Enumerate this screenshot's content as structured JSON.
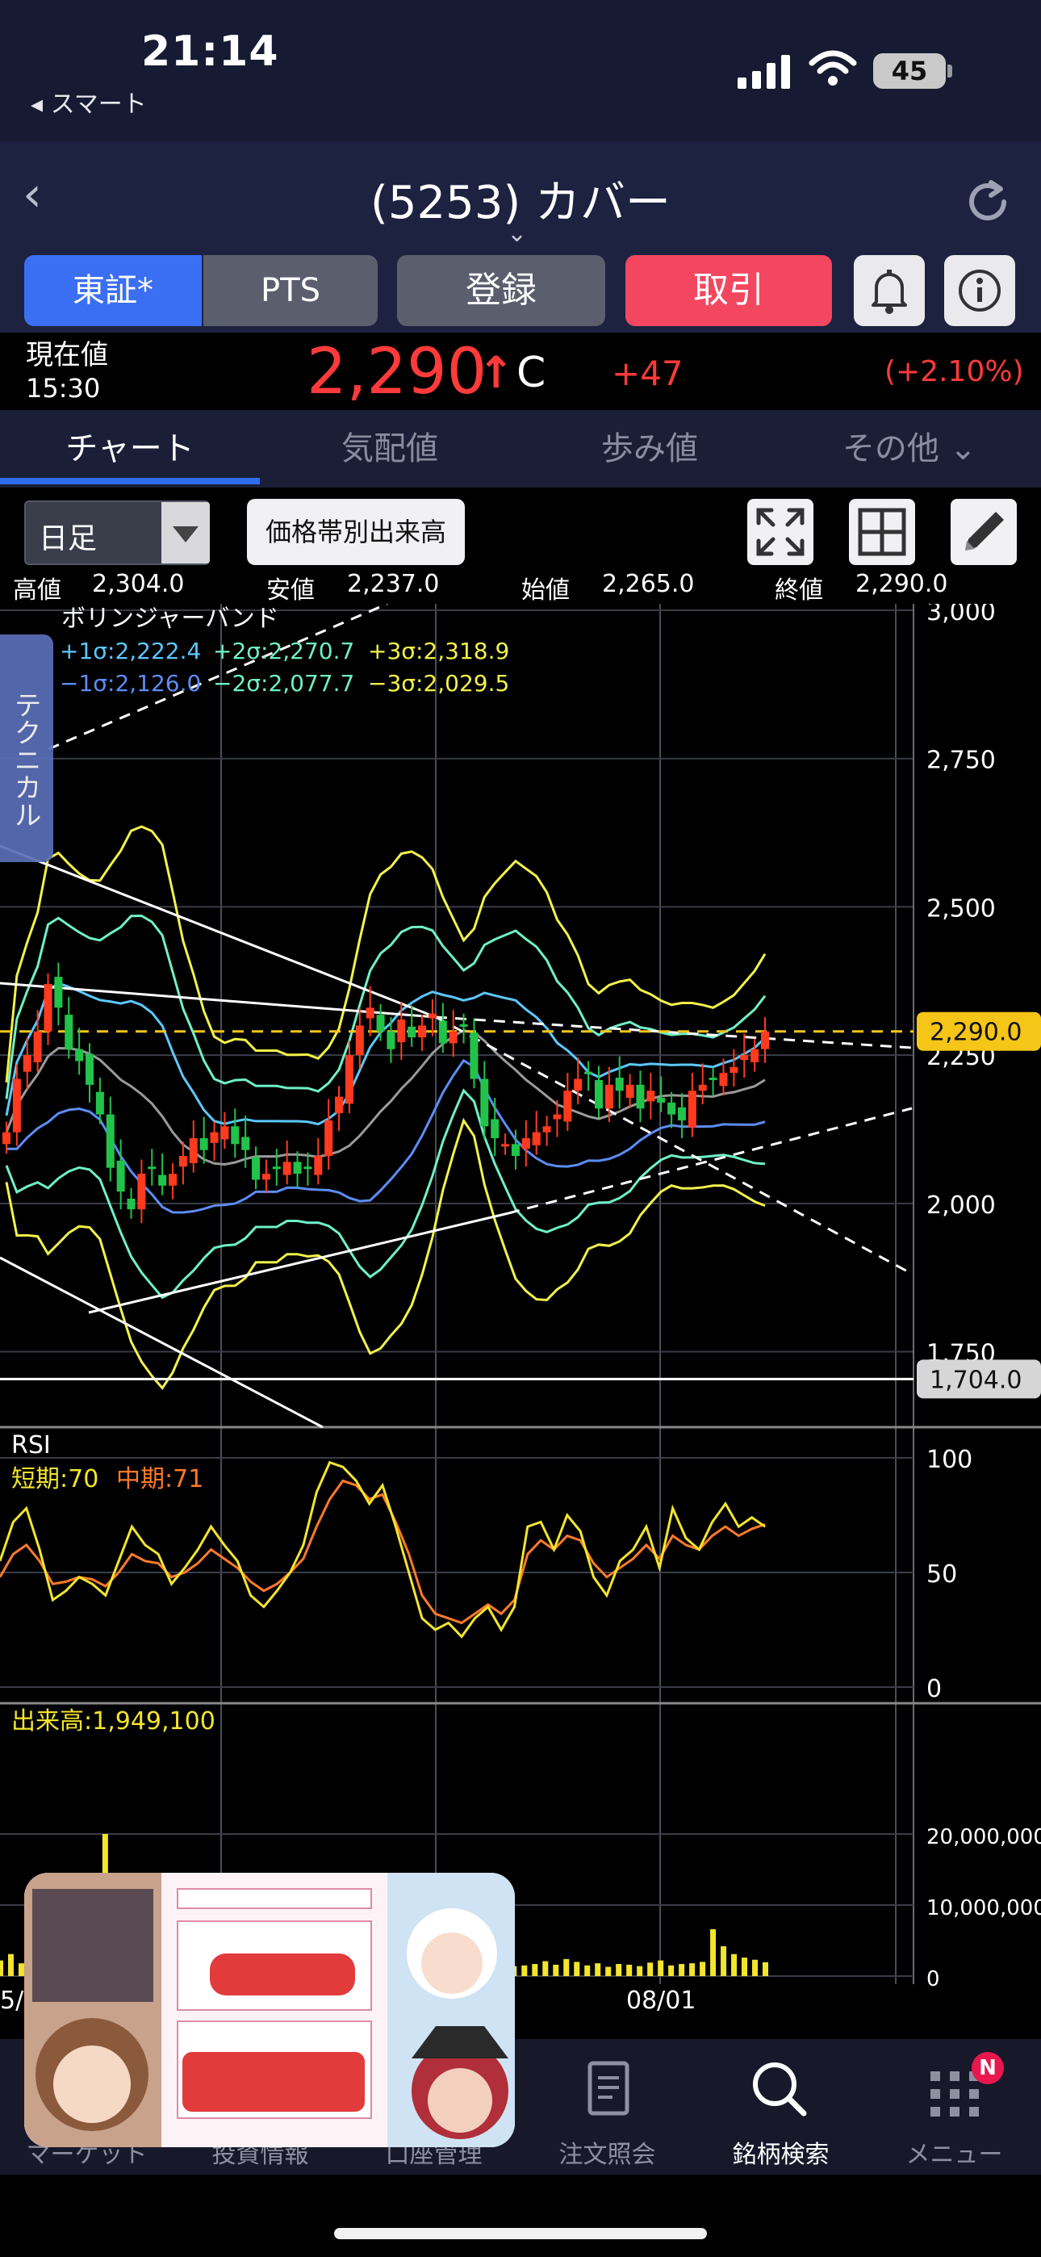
{
  "status": {
    "time": "21:14",
    "back_app": "◂ スマート",
    "battery": "45"
  },
  "nav": {
    "title": "(5253) カバー"
  },
  "buttons": {
    "tse": "東証*",
    "pts": "PTS",
    "register": "登録",
    "trade": "取引"
  },
  "price": {
    "label": "現在値",
    "time": "15:30",
    "value": "2,290",
    "arrow": "↑",
    "flag": "C",
    "change": "+47",
    "change_pct": "(+2.10%)"
  },
  "tabs": [
    "チャート",
    "気配値",
    "歩み値",
    "その他 ⌄"
  ],
  "toolbar": {
    "period": "日足",
    "volume_profile": "価格帯別出来高"
  },
  "ohlc": {
    "high_label": "高値",
    "high": "2,304.0",
    "low_label": "安値",
    "low": "2,237.0",
    "open_label": "始値",
    "open": "2,265.0",
    "close_label": "終値",
    "close": "2,290.0"
  },
  "side_tab": "テクニカル",
  "colors": {
    "up": "#ff3a1f",
    "down": "#22c34a",
    "bb_yellow": "#f2f24a",
    "bb_green": "#6ff0c8",
    "bb_blue": "#5c8df5",
    "rsi_short": "#f2e52c",
    "rsi_mid": "#ff7a2a",
    "current_price": "#f5c518"
  },
  "chart_data": [
    {
      "type": "candlestick",
      "title": "ボリンジャーバンド",
      "legend": {
        "p1": "+1σ:2,222.4",
        "p2": "+2σ:2,270.7",
        "p3": "+3σ:2,318.9",
        "m1": "−1σ:2,126.0",
        "m2": "−2σ:2,077.7",
        "m3": "−3σ:2,029.5"
      },
      "y_ticks": [
        "3,000",
        "2,750",
        "2,500",
        "2,250",
        "2,000",
        "1,750"
      ],
      "ylim": [
        1650,
        3000
      ],
      "current_price_label": "2,290.0",
      "support_label": "1,704.0",
      "x_tick_labels": [
        "5/",
        "08/01"
      ],
      "closes": [
        2120,
        2210,
        2250,
        2290,
        2370,
        2330,
        2260,
        2240,
        2200,
        2150,
        2060,
        2020,
        1990,
        2050,
        2060,
        2030,
        2050,
        2080,
        2110,
        2090,
        2120,
        2130,
        2100,
        2090,
        2040,
        2050,
        2060,
        2070,
        2050,
        2060,
        2080,
        2140,
        2180,
        2250,
        2300,
        2330,
        2290,
        2260,
        2310,
        2280,
        2300,
        2320,
        2270,
        2290,
        2300,
        2210,
        2130,
        2110,
        2100,
        2080,
        2110,
        2120,
        2130,
        2150,
        2190,
        2210,
        2220,
        2160,
        2200,
        2190,
        2200,
        2160,
        2190,
        2170,
        2150,
        2140,
        2190,
        2200,
        2210,
        2220,
        2230,
        2250,
        2260,
        2290
      ]
    },
    {
      "type": "line",
      "title": "RSI",
      "series": [
        {
          "name": "短期:70"
        },
        {
          "name": "中期:71"
        }
      ],
      "y_ticks": [
        "100",
        "50",
        "0"
      ],
      "ylim": [
        0,
        100
      ],
      "short": [
        55,
        72,
        78,
        60,
        38,
        42,
        48,
        45,
        40,
        55,
        70,
        62,
        58,
        45,
        52,
        60,
        70,
        62,
        55,
        40,
        35,
        42,
        50,
        62,
        85,
        98,
        96,
        90,
        80,
        88,
        70,
        50,
        30,
        25,
        28,
        22,
        30,
        35,
        25,
        35,
        70,
        72,
        60,
        75,
        68,
        48,
        40,
        55,
        60,
        70,
        52,
        78,
        65,
        60,
        72,
        80,
        70,
        74,
        70
      ],
      "mid": [
        48,
        58,
        62,
        55,
        45,
        46,
        48,
        47,
        44,
        50,
        58,
        55,
        54,
        48,
        50,
        54,
        60,
        56,
        52,
        46,
        42,
        45,
        50,
        56,
        70,
        82,
        90,
        88,
        82,
        84,
        72,
        58,
        40,
        32,
        30,
        28,
        32,
        36,
        32,
        38,
        58,
        64,
        60,
        66,
        64,
        54,
        48,
        52,
        56,
        62,
        56,
        66,
        62,
        60,
        66,
        70,
        66,
        69,
        71
      ]
    },
    {
      "type": "bar",
      "title": "出来高:1,949,100",
      "y_ticks": [
        "20,000,000",
        "10,000,000",
        "0"
      ],
      "ylim": [
        0,
        25000000
      ],
      "values": [
        2200000,
        3100000,
        1800000,
        2600000,
        1500000,
        2900000,
        1700000,
        2300000,
        1300000,
        1900000,
        20000000,
        3000000,
        2200000,
        1600000,
        2800000,
        1700000,
        2100000,
        1400000,
        1800000,
        1200000,
        1500000,
        1300000,
        1100000,
        1400000,
        1600000,
        2000000,
        2400000,
        1800000,
        2200000,
        1500000,
        1400000,
        1700000,
        1300000,
        1900000,
        2300000,
        1600000,
        1400000,
        1800000,
        2600000,
        2100000,
        1500000,
        4200000,
        2800000,
        1900000,
        2300000,
        1700000,
        1600000,
        2200000,
        1800000,
        1400000,
        1500000,
        1700000,
        2100000,
        1600000,
        2400000,
        2000000,
        1500000,
        1800000,
        1300000,
        1700000,
        1600000,
        1400000,
        1900000,
        2200000,
        1500000,
        1700000,
        1800000,
        2000000,
        6600000,
        4200000,
        3100000,
        2600000,
        2300000,
        1949100
      ]
    }
  ],
  "bottom_nav": [
    "マーケット",
    "投資情報",
    "口座管理",
    "注文照会",
    "銘柄検索",
    "メニュー"
  ],
  "badge": "N"
}
